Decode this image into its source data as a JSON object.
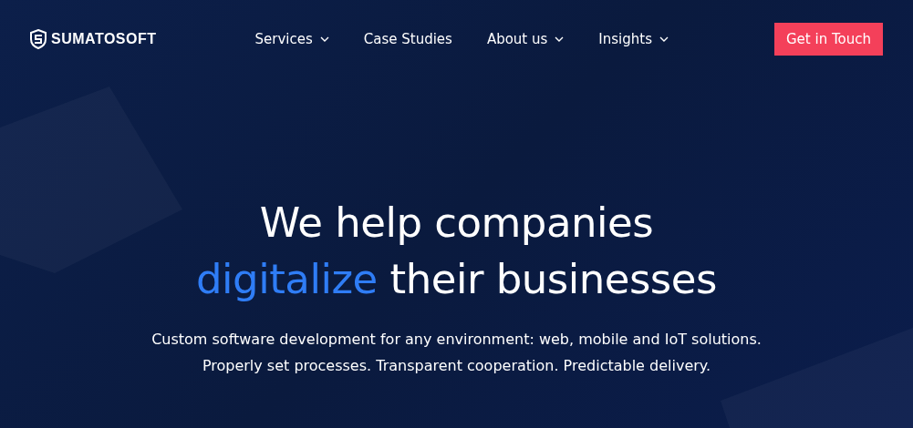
{
  "header": {
    "logo": "SUMATOSOFT",
    "nav": [
      {
        "label": "Services",
        "dropdown": true
      },
      {
        "label": "Case Studies",
        "dropdown": false
      },
      {
        "label": "About us",
        "dropdown": true
      },
      {
        "label": "Insights",
        "dropdown": true
      }
    ],
    "cta": "Get in Touch"
  },
  "hero": {
    "headline_line_1": "We help companies",
    "headline_accent": "digitalize",
    "headline_rest": "their businesses",
    "subtitle_lines": [
      "Custom software development for any environment: web, mobile and IoT solutions.",
      "Properly set processes. Transparent cooperation. Predictable delivery."
    ]
  }
}
